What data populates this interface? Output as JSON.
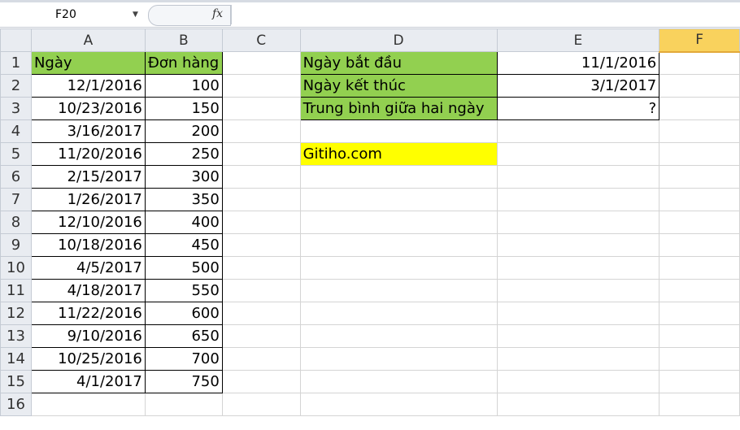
{
  "formula_bar": {
    "name_box": "F20",
    "formula": ""
  },
  "columns": [
    "A",
    "B",
    "C",
    "D",
    "E",
    "F"
  ],
  "selected_column": "F",
  "rows": [
    {
      "n": "1",
      "A": "Ngày",
      "B": "Đơn hàng",
      "D": "Ngày bắt đầu",
      "E": "11/1/2016"
    },
    {
      "n": "2",
      "A": "12/1/2016",
      "B": "100",
      "D": "Ngày kết thúc",
      "E": "3/1/2017"
    },
    {
      "n": "3",
      "A": "10/23/2016",
      "B": "150",
      "D": "Trung bình giữa hai ngày",
      "E": "?"
    },
    {
      "n": "4",
      "A": "3/16/2017",
      "B": "200"
    },
    {
      "n": "5",
      "A": "11/20/2016",
      "B": "250",
      "D": "Gitiho.com"
    },
    {
      "n": "6",
      "A": "2/15/2017",
      "B": "300"
    },
    {
      "n": "7",
      "A": "1/26/2017",
      "B": "350"
    },
    {
      "n": "8",
      "A": "12/10/2016",
      "B": "400"
    },
    {
      "n": "9",
      "A": "10/18/2016",
      "B": "450"
    },
    {
      "n": "10",
      "A": "4/5/2017",
      "B": "500"
    },
    {
      "n": "11",
      "A": "4/18/2017",
      "B": "550"
    },
    {
      "n": "12",
      "A": "11/22/2016",
      "B": "600"
    },
    {
      "n": "13",
      "A": "9/10/2016",
      "B": "650"
    },
    {
      "n": "14",
      "A": "10/25/2016",
      "B": "700"
    },
    {
      "n": "15",
      "A": "4/1/2017",
      "B": "750"
    },
    {
      "n": "16"
    }
  ],
  "colors": {
    "header_fill": "#92d050",
    "highlight": "#ffff00",
    "selected_header": "#f9d25d"
  }
}
